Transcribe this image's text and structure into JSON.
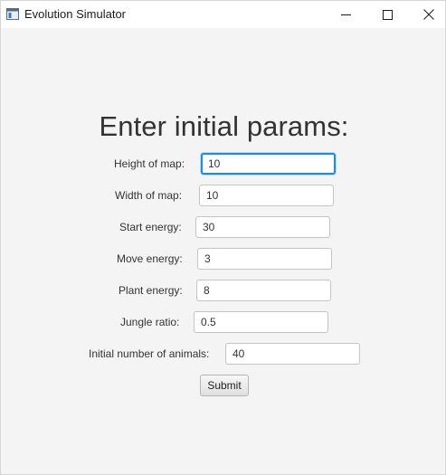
{
  "window": {
    "title": "Evolution Simulator"
  },
  "form": {
    "heading": "Enter initial params:",
    "fields": [
      {
        "label": "Height of map:",
        "value": "10"
      },
      {
        "label": "Width of map:",
        "value": "10"
      },
      {
        "label": "Start energy:",
        "value": "30"
      },
      {
        "label": "Move energy:",
        "value": "3"
      },
      {
        "label": "Plant energy:",
        "value": "8"
      },
      {
        "label": "Jungle ratio:",
        "value": "0.5"
      },
      {
        "label": "Initial number of animals:",
        "value": "40"
      }
    ],
    "submit_label": "Submit"
  },
  "colors": {
    "background": "#f4f4f4",
    "focus_border": "#1f8dd6",
    "text": "#333333"
  },
  "icons": {
    "app": "app-window-icon",
    "minimize": "minimize-icon",
    "maximize": "maximize-icon",
    "close": "close-icon"
  }
}
